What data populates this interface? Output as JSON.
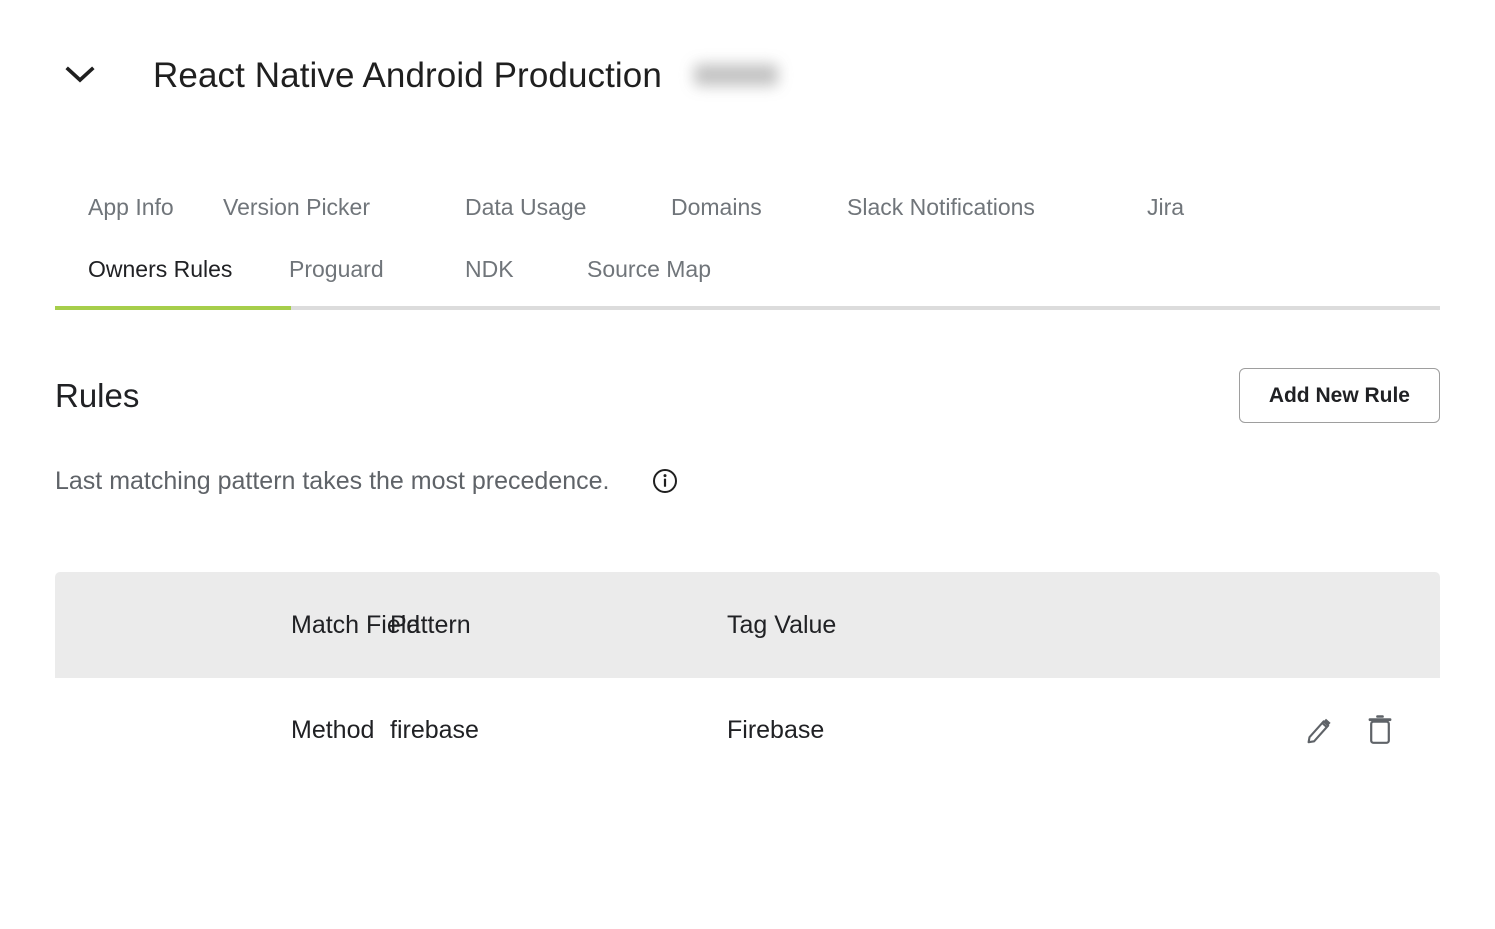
{
  "header": {
    "title": "React Native Android Production",
    "chevron_icon": "chevron-down-icon",
    "redacted_label": ""
  },
  "tabs": {
    "row1": [
      {
        "label": "App Info",
        "active": false
      },
      {
        "label": "Version Picker",
        "active": false
      },
      {
        "label": "Data Usage",
        "active": false
      },
      {
        "label": "Domains",
        "active": false
      },
      {
        "label": "Slack Notifications",
        "active": false
      },
      {
        "label": "Jira",
        "active": false
      }
    ],
    "row2": [
      {
        "label": "Owners Rules",
        "active": true
      },
      {
        "label": "Proguard",
        "active": false
      },
      {
        "label": "NDK",
        "active": false
      },
      {
        "label": "Source Map",
        "active": false
      }
    ],
    "active_underline_color": "#a6ce4b",
    "track_color": "#dcdcdc"
  },
  "rules_section": {
    "title": "Rules",
    "add_button_label": "Add New Rule",
    "precedence_note": "Last matching pattern takes the most precedence.",
    "info_icon": "info-circle-icon"
  },
  "table": {
    "columns": [
      "Match Field",
      "Pattern",
      "Tag Value"
    ],
    "rows": [
      {
        "match_field": "Method",
        "pattern": "firebase",
        "tag_value": "Firebase",
        "edit_icon": "pencil-edit-icon",
        "delete_icon": "trash-delete-icon"
      }
    ],
    "header_bg": "#ebebeb"
  }
}
